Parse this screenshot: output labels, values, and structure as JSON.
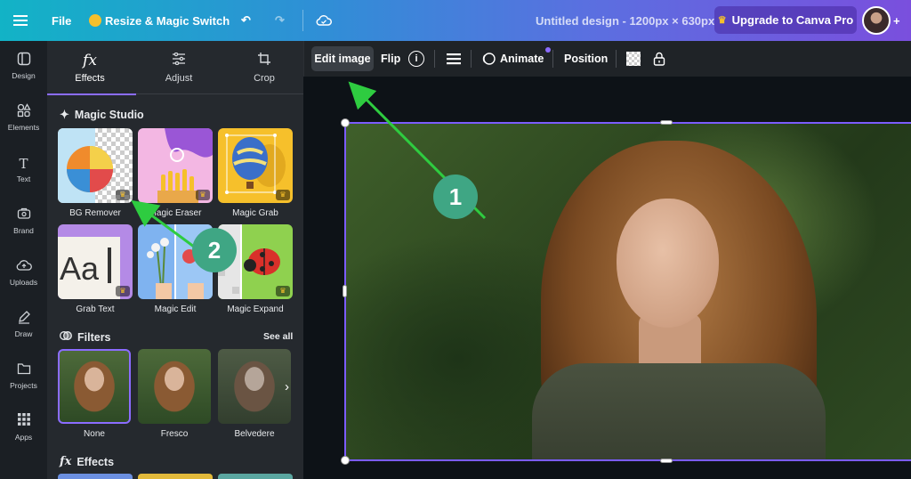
{
  "topbar": {
    "file_label": "File",
    "resize_label": "Resize & Magic Switch",
    "doc_title": "Untitled design - 1200px × 630px",
    "upgrade_label": "Upgrade to Canva Pro",
    "icons": [
      "menu-icon",
      "crown-icon",
      "undo-icon",
      "redo-icon",
      "cloud-sync-icon",
      "avatar",
      "plus-icon"
    ]
  },
  "rail": {
    "items": [
      {
        "label": "Design",
        "icon": "design-icon"
      },
      {
        "label": "Elements",
        "icon": "elements-icon"
      },
      {
        "label": "Text",
        "icon": "text-icon"
      },
      {
        "label": "Brand",
        "icon": "brand-icon"
      },
      {
        "label": "Uploads",
        "icon": "uploads-icon"
      },
      {
        "label": "Draw",
        "icon": "draw-icon"
      },
      {
        "label": "Projects",
        "icon": "projects-icon"
      },
      {
        "label": "Apps",
        "icon": "apps-icon"
      }
    ]
  },
  "panel": {
    "tabs": [
      {
        "label": "Effects",
        "icon": "fx-icon",
        "active": true
      },
      {
        "label": "Adjust",
        "icon": "sliders-icon"
      },
      {
        "label": "Crop",
        "icon": "crop-icon"
      }
    ],
    "magic_studio": {
      "title": "Magic Studio",
      "tiles": [
        "BG Remover",
        "Magic Eraser",
        "Magic Grab",
        "Grab Text",
        "Magic Edit",
        "Magic Expand"
      ]
    },
    "filters": {
      "title": "Filters",
      "see_all": "See all",
      "items": [
        "None",
        "Fresco",
        "Belvedere"
      ],
      "selected": "None"
    },
    "effects": {
      "title": "Effects"
    }
  },
  "toolbar": {
    "edit_image": "Edit image",
    "flip": "Flip",
    "animate": "Animate",
    "position": "Position",
    "info_glyph": "i"
  },
  "annotations": {
    "badge_1": "1",
    "badge_2": "2",
    "arrow_color": "#2ecc40",
    "badge_color": "#3fa684"
  },
  "colors": {
    "accent": "#8b6cff",
    "crown": "#f6c02b"
  }
}
